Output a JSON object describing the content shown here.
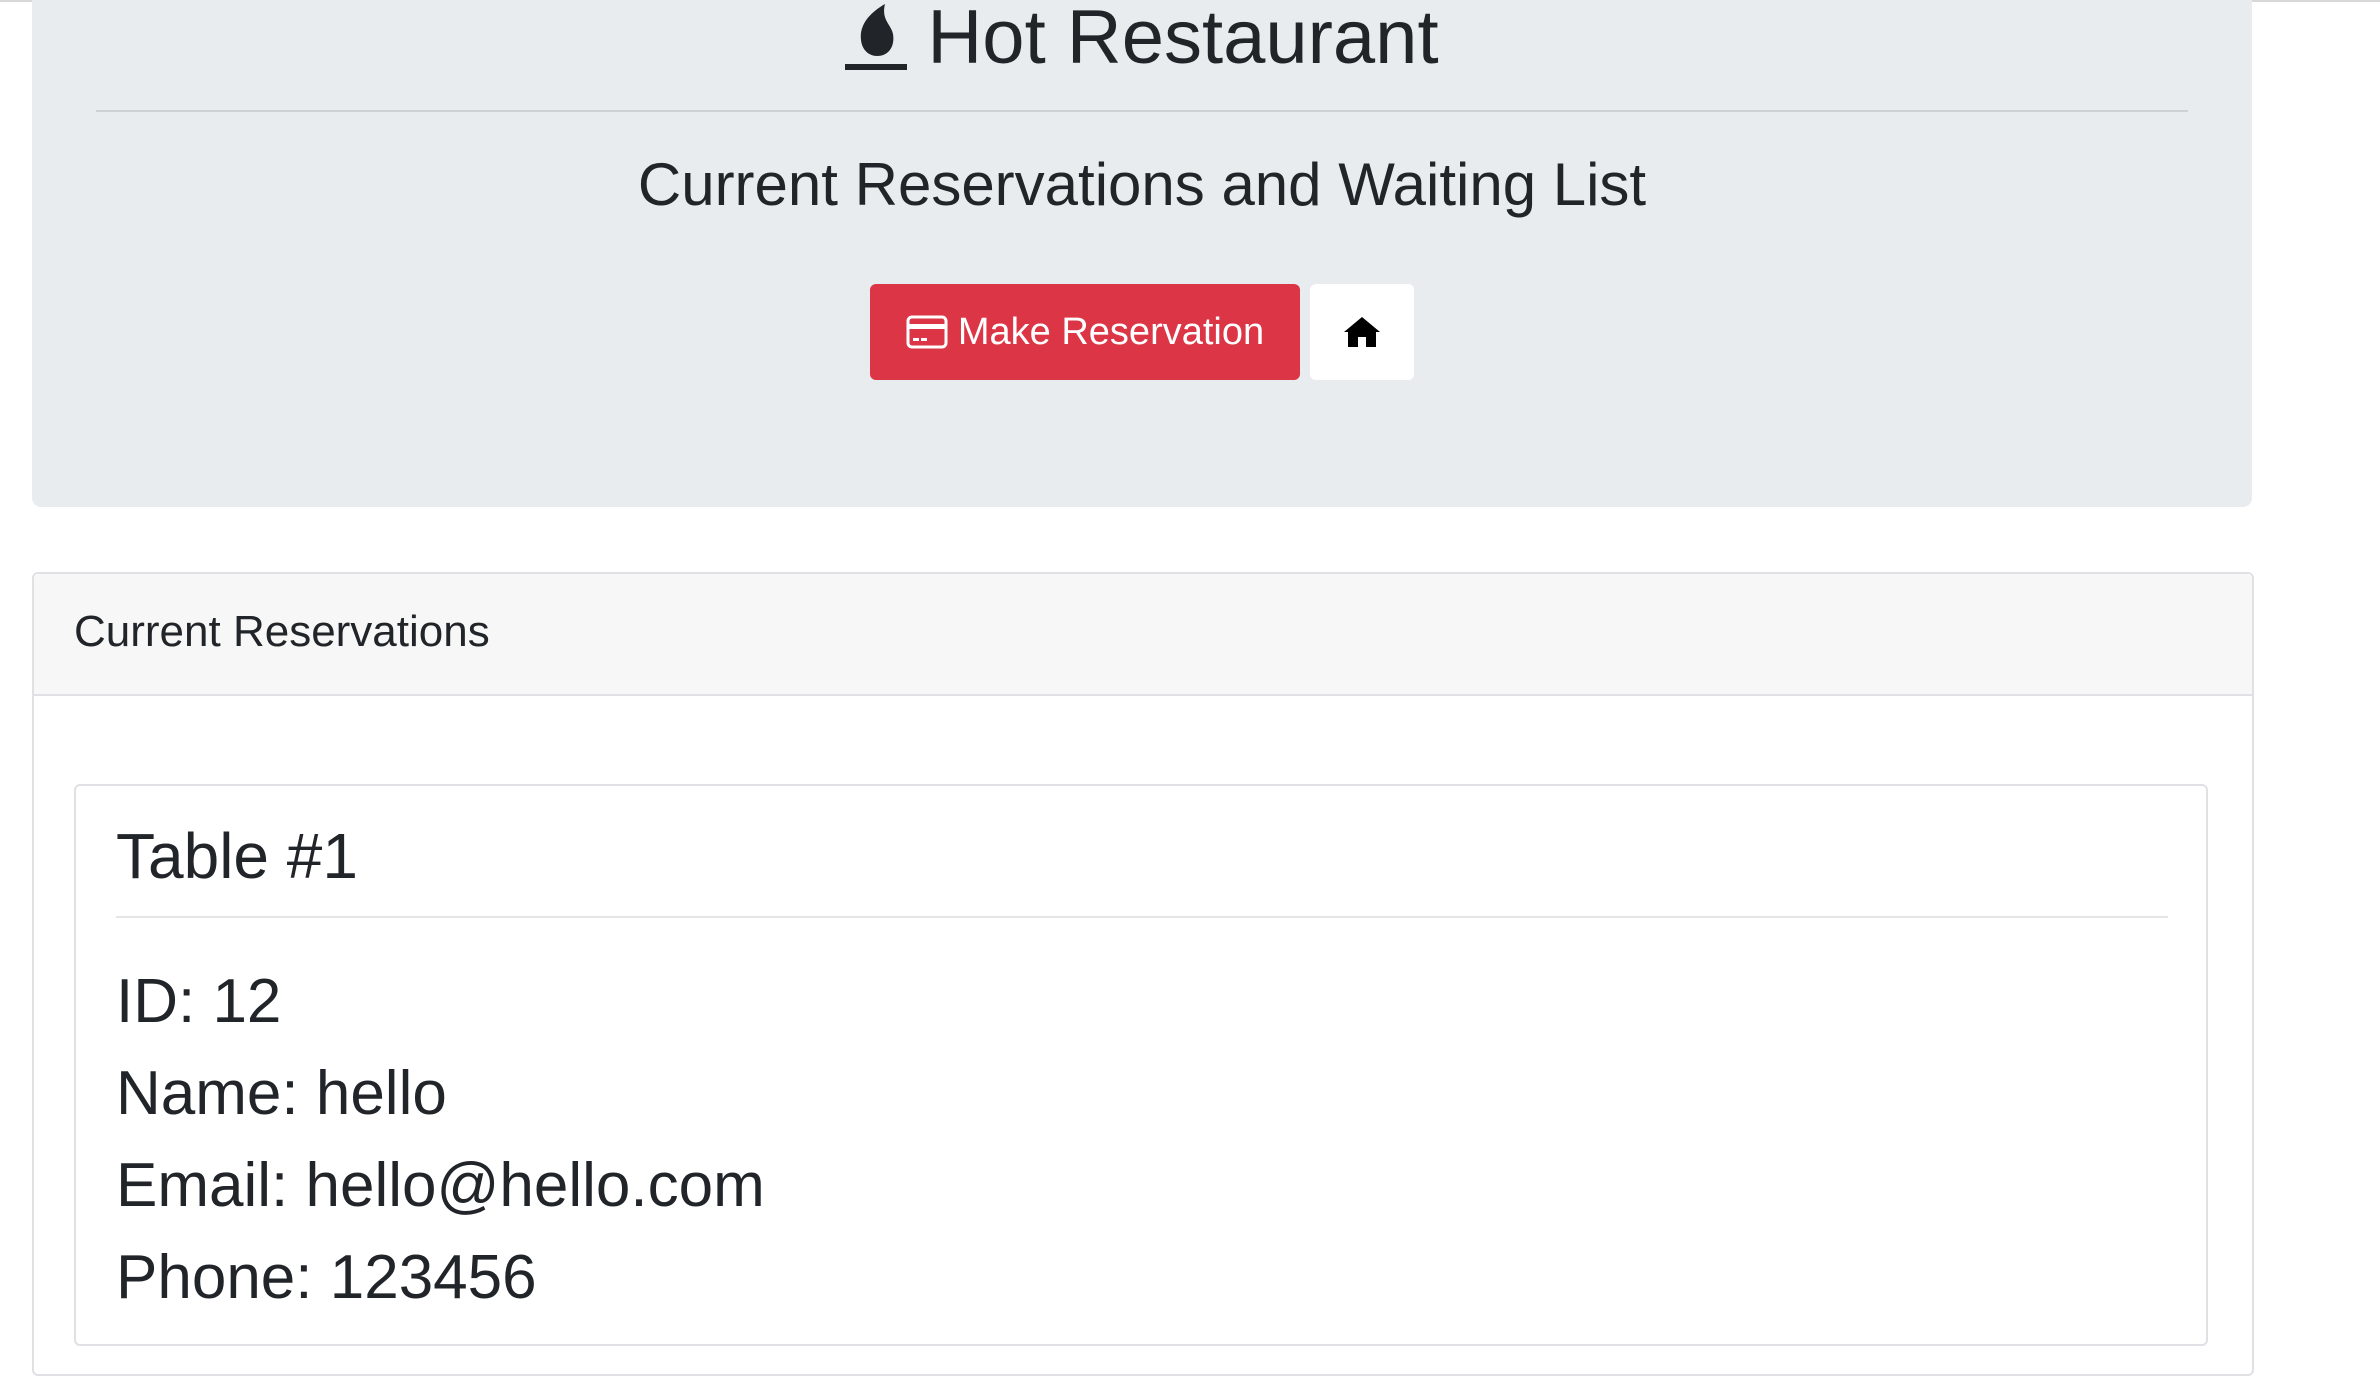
{
  "header": {
    "brand_title": "Hot Restaurant",
    "subtitle": "Current Reservations and Waiting List",
    "brand_icon": "fire-icon"
  },
  "actions": {
    "make_reservation_label": "Make Reservation",
    "make_reservation_icon": "credit-card-icon",
    "home_icon": "home-icon"
  },
  "colors": {
    "accent_danger": "#dc3545",
    "jumbotron_bg": "#e9ecef",
    "card_header_bg": "#f7f7f7"
  },
  "current_reservations": {
    "heading": "Current Reservations",
    "tables": [
      {
        "title": "Table #1",
        "id_line": "ID: 12",
        "name_line": "Name: hello",
        "email_line": "Email: hello@hello.com",
        "phone_line": "Phone: 123456"
      }
    ]
  }
}
